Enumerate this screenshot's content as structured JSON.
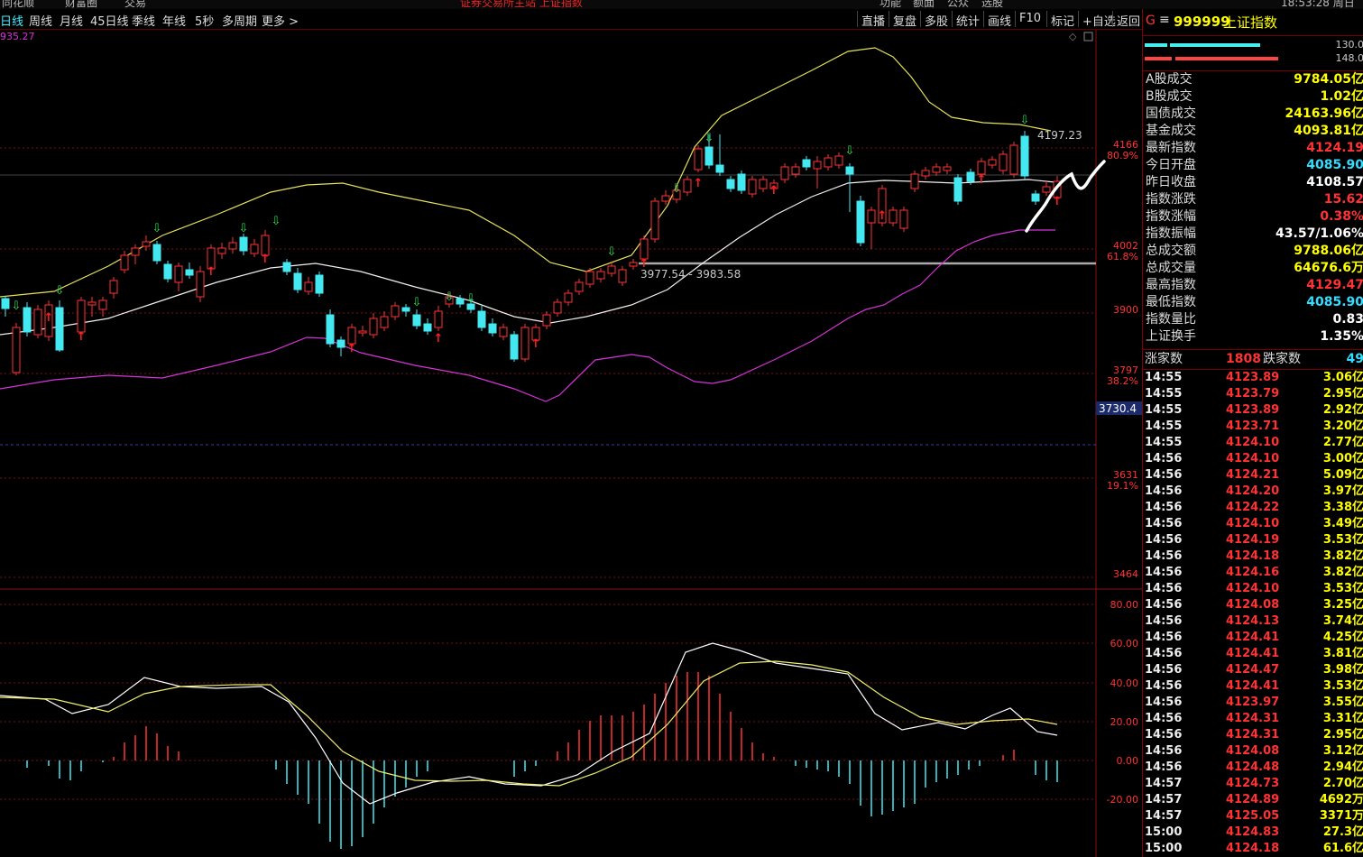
{
  "top_strip": {
    "title": "证券交易所主站 上证指数",
    "items": [
      "同花顺",
      "财富圈",
      "交易",
      "功能",
      "额面",
      "公众",
      "选股",
      "18:53:28 周日"
    ]
  },
  "toolbar": {
    "left": [
      "日线",
      "周线",
      "月线",
      "45日线",
      "季线",
      "年线",
      "5秒",
      "多周期",
      "更多 >"
    ],
    "right": [
      "直播",
      "复盘",
      "多股",
      "统计",
      "画线",
      "F10",
      "标记",
      "+自选",
      "返回"
    ]
  },
  "chart": {
    "ma_label": "935.27",
    "price_labels": [
      {
        "price": "4166",
        "pct": "80.9%"
      },
      {
        "price": "4002",
        "pct": "61.8%"
      },
      {
        "price": "3900",
        "pct": ""
      },
      {
        "price": "3797",
        "pct": "38.2%"
      },
      {
        "price": "3631",
        "pct": "19.1%"
      },
      {
        "price": "3464",
        "pct": ""
      }
    ],
    "cursor_price": "3730.4",
    "high_annotation": "4197.23",
    "gap_annotation": "3977.54 - 3983.58",
    "macd_labels": [
      "80.00",
      "60.00",
      "40.00",
      "20.00",
      "0.00",
      "-20.00"
    ],
    "colors": {
      "up": "#ff3333",
      "down": "#44e8f0",
      "upper_band": "#e6e05a",
      "mid_band": "#f0f0f0",
      "lower_band": "#d633d6",
      "diff": "#ffffff",
      "dea": "#f0f06a",
      "grid": "#7a1010"
    }
  },
  "panel": {
    "header": {
      "icon": "G",
      "code": "999999",
      "name": "上证指数"
    },
    "bars": [
      {
        "value": "130.0"
      },
      {
        "value": "148.0"
      }
    ],
    "stats": [
      {
        "label": "A股成交",
        "value": "9784.05亿",
        "color": "#ffff00"
      },
      {
        "label": "B股成交",
        "value": "1.02亿",
        "color": "#ffff00"
      },
      {
        "label": "国债成交",
        "value": "24163.96亿",
        "color": "#ffff00"
      },
      {
        "label": "基金成交",
        "value": "4093.81亿",
        "color": "#ffff00"
      },
      {
        "label": "最新指数",
        "value": "4124.19",
        "color": "#ff3333"
      },
      {
        "label": "今日开盘",
        "value": "4085.90",
        "color": "#33ddff"
      },
      {
        "label": "昨日收盘",
        "value": "4108.57",
        "color": "#ffffff"
      },
      {
        "label": "指数涨跌",
        "value": "15.62",
        "color": "#ff3333"
      },
      {
        "label": "指数涨幅",
        "value": "0.38%",
        "color": "#ff3333"
      },
      {
        "label": "指数振幅",
        "value": "43.57/1.06%",
        "color": "#ffffff"
      },
      {
        "label": "总成交额",
        "value": "9788.06亿",
        "color": "#ffff00"
      },
      {
        "label": "总成交量",
        "value": "64676.6万",
        "color": "#ffff00"
      },
      {
        "label": "最高指数",
        "value": "4129.47",
        "color": "#ff3333"
      },
      {
        "label": "最低指数",
        "value": "4085.90",
        "color": "#33ddff"
      },
      {
        "label": "指数量比",
        "value": "0.83",
        "color": "#ffffff"
      },
      {
        "label": "上证换手",
        "value": "1.35%",
        "color": "#ffffff"
      }
    ],
    "advance_decline": {
      "up_label": "涨家数",
      "up": "1808",
      "down_label": "跌家数",
      "down": "49"
    },
    "ticks": [
      {
        "time": "14:55",
        "price": "4123.89",
        "vol": "3.06亿"
      },
      {
        "time": "14:55",
        "price": "4123.79",
        "vol": "2.95亿"
      },
      {
        "time": "14:55",
        "price": "4123.89",
        "vol": "2.92亿"
      },
      {
        "time": "14:55",
        "price": "4123.71",
        "vol": "3.20亿"
      },
      {
        "time": "14:55",
        "price": "4124.10",
        "vol": "2.77亿"
      },
      {
        "time": "14:56",
        "price": "4124.10",
        "vol": "3.00亿"
      },
      {
        "time": "14:56",
        "price": "4124.21",
        "vol": "5.09亿"
      },
      {
        "time": "14:56",
        "price": "4124.20",
        "vol": "3.97亿"
      },
      {
        "time": "14:56",
        "price": "4124.22",
        "vol": "3.38亿"
      },
      {
        "time": "14:56",
        "price": "4124.10",
        "vol": "3.49亿"
      },
      {
        "time": "14:56",
        "price": "4124.19",
        "vol": "3.53亿"
      },
      {
        "time": "14:56",
        "price": "4124.18",
        "vol": "3.82亿"
      },
      {
        "time": "14:56",
        "price": "4124.16",
        "vol": "3.82亿"
      },
      {
        "time": "14:56",
        "price": "4124.10",
        "vol": "3.53亿"
      },
      {
        "time": "14:56",
        "price": "4124.08",
        "vol": "3.25亿"
      },
      {
        "time": "14:56",
        "price": "4124.13",
        "vol": "3.74亿"
      },
      {
        "time": "14:56",
        "price": "4124.41",
        "vol": "4.25亿"
      },
      {
        "time": "14:56",
        "price": "4124.41",
        "vol": "3.81亿"
      },
      {
        "time": "14:56",
        "price": "4124.47",
        "vol": "3.98亿"
      },
      {
        "time": "14:56",
        "price": "4124.41",
        "vol": "3.53亿"
      },
      {
        "time": "14:56",
        "price": "4123.97",
        "vol": "3.55亿"
      },
      {
        "time": "14:56",
        "price": "4124.31",
        "vol": "3.31亿"
      },
      {
        "time": "14:56",
        "price": "4124.31",
        "vol": "2.95亿"
      },
      {
        "time": "14:56",
        "price": "4124.08",
        "vol": "3.12亿"
      },
      {
        "time": "14:56",
        "price": "4124.48",
        "vol": "2.94亿"
      },
      {
        "time": "14:57",
        "price": "4124.73",
        "vol": "2.70亿"
      },
      {
        "time": "14:57",
        "price": "4124.89",
        "vol": "4692万"
      },
      {
        "time": "14:57",
        "price": "4125.05",
        "vol": "3371万"
      },
      {
        "time": "15:00",
        "price": "4124.83",
        "vol": "27.3亿"
      },
      {
        "time": "15:00",
        "price": "4124.18",
        "vol": "61.6亿"
      }
    ]
  }
}
